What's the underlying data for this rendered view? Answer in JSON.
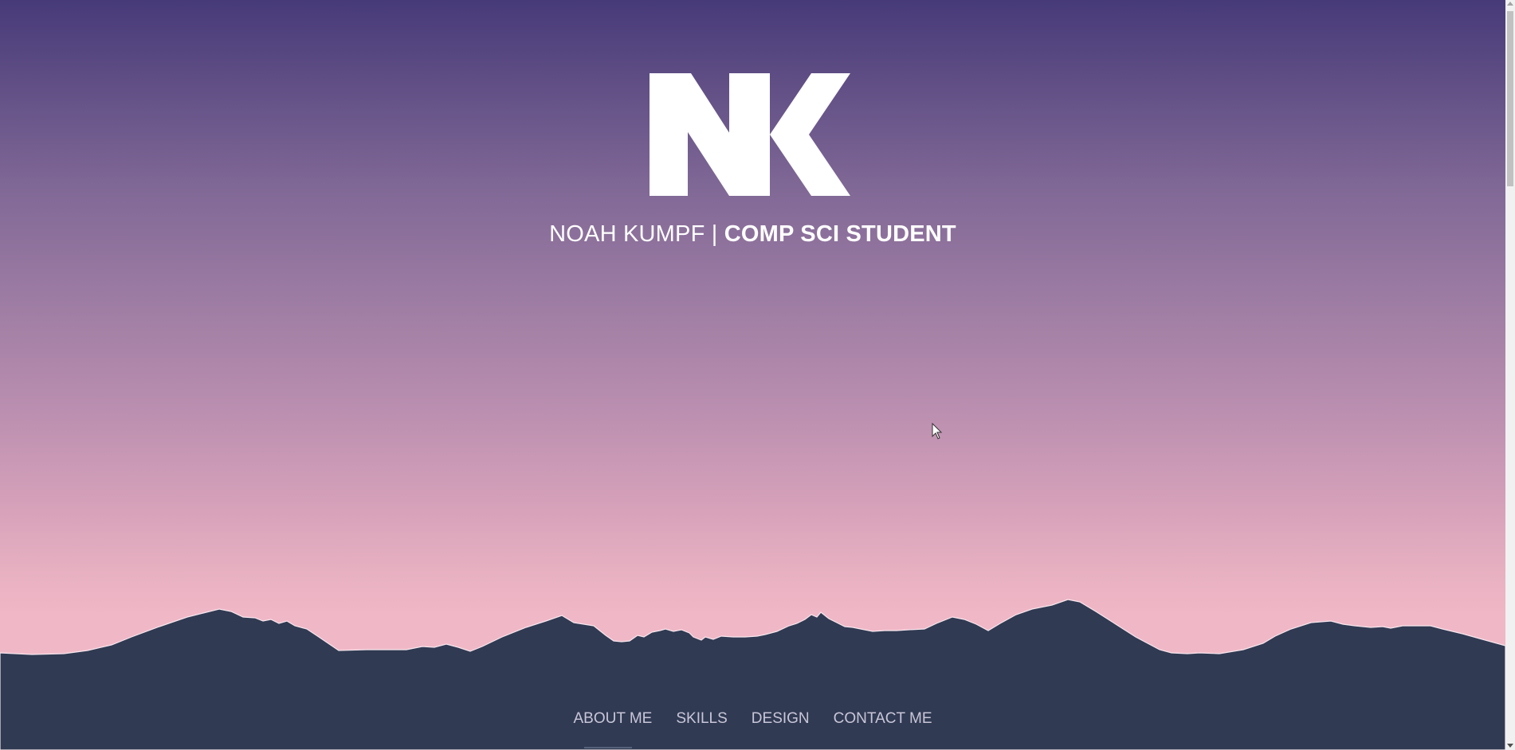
{
  "hero": {
    "logo_text": "NK",
    "name": "NOAH KUMPF",
    "separator": " | ",
    "role": "COMP SCI STUDENT"
  },
  "nav": {
    "items": [
      {
        "label": "ABOUT ME"
      },
      {
        "label": "SKILLS"
      },
      {
        "label": "DESIGN"
      },
      {
        "label": "CONTACT ME"
      }
    ]
  },
  "colors": {
    "sky_top": "#473a79",
    "sky_bottom": "#f2b9c7",
    "mountain": "#303a52",
    "nav_text": "#c9c6d9"
  },
  "icons": {
    "logo": "nk-monogram-logo",
    "cursor": "mouse-pointer-icon"
  }
}
